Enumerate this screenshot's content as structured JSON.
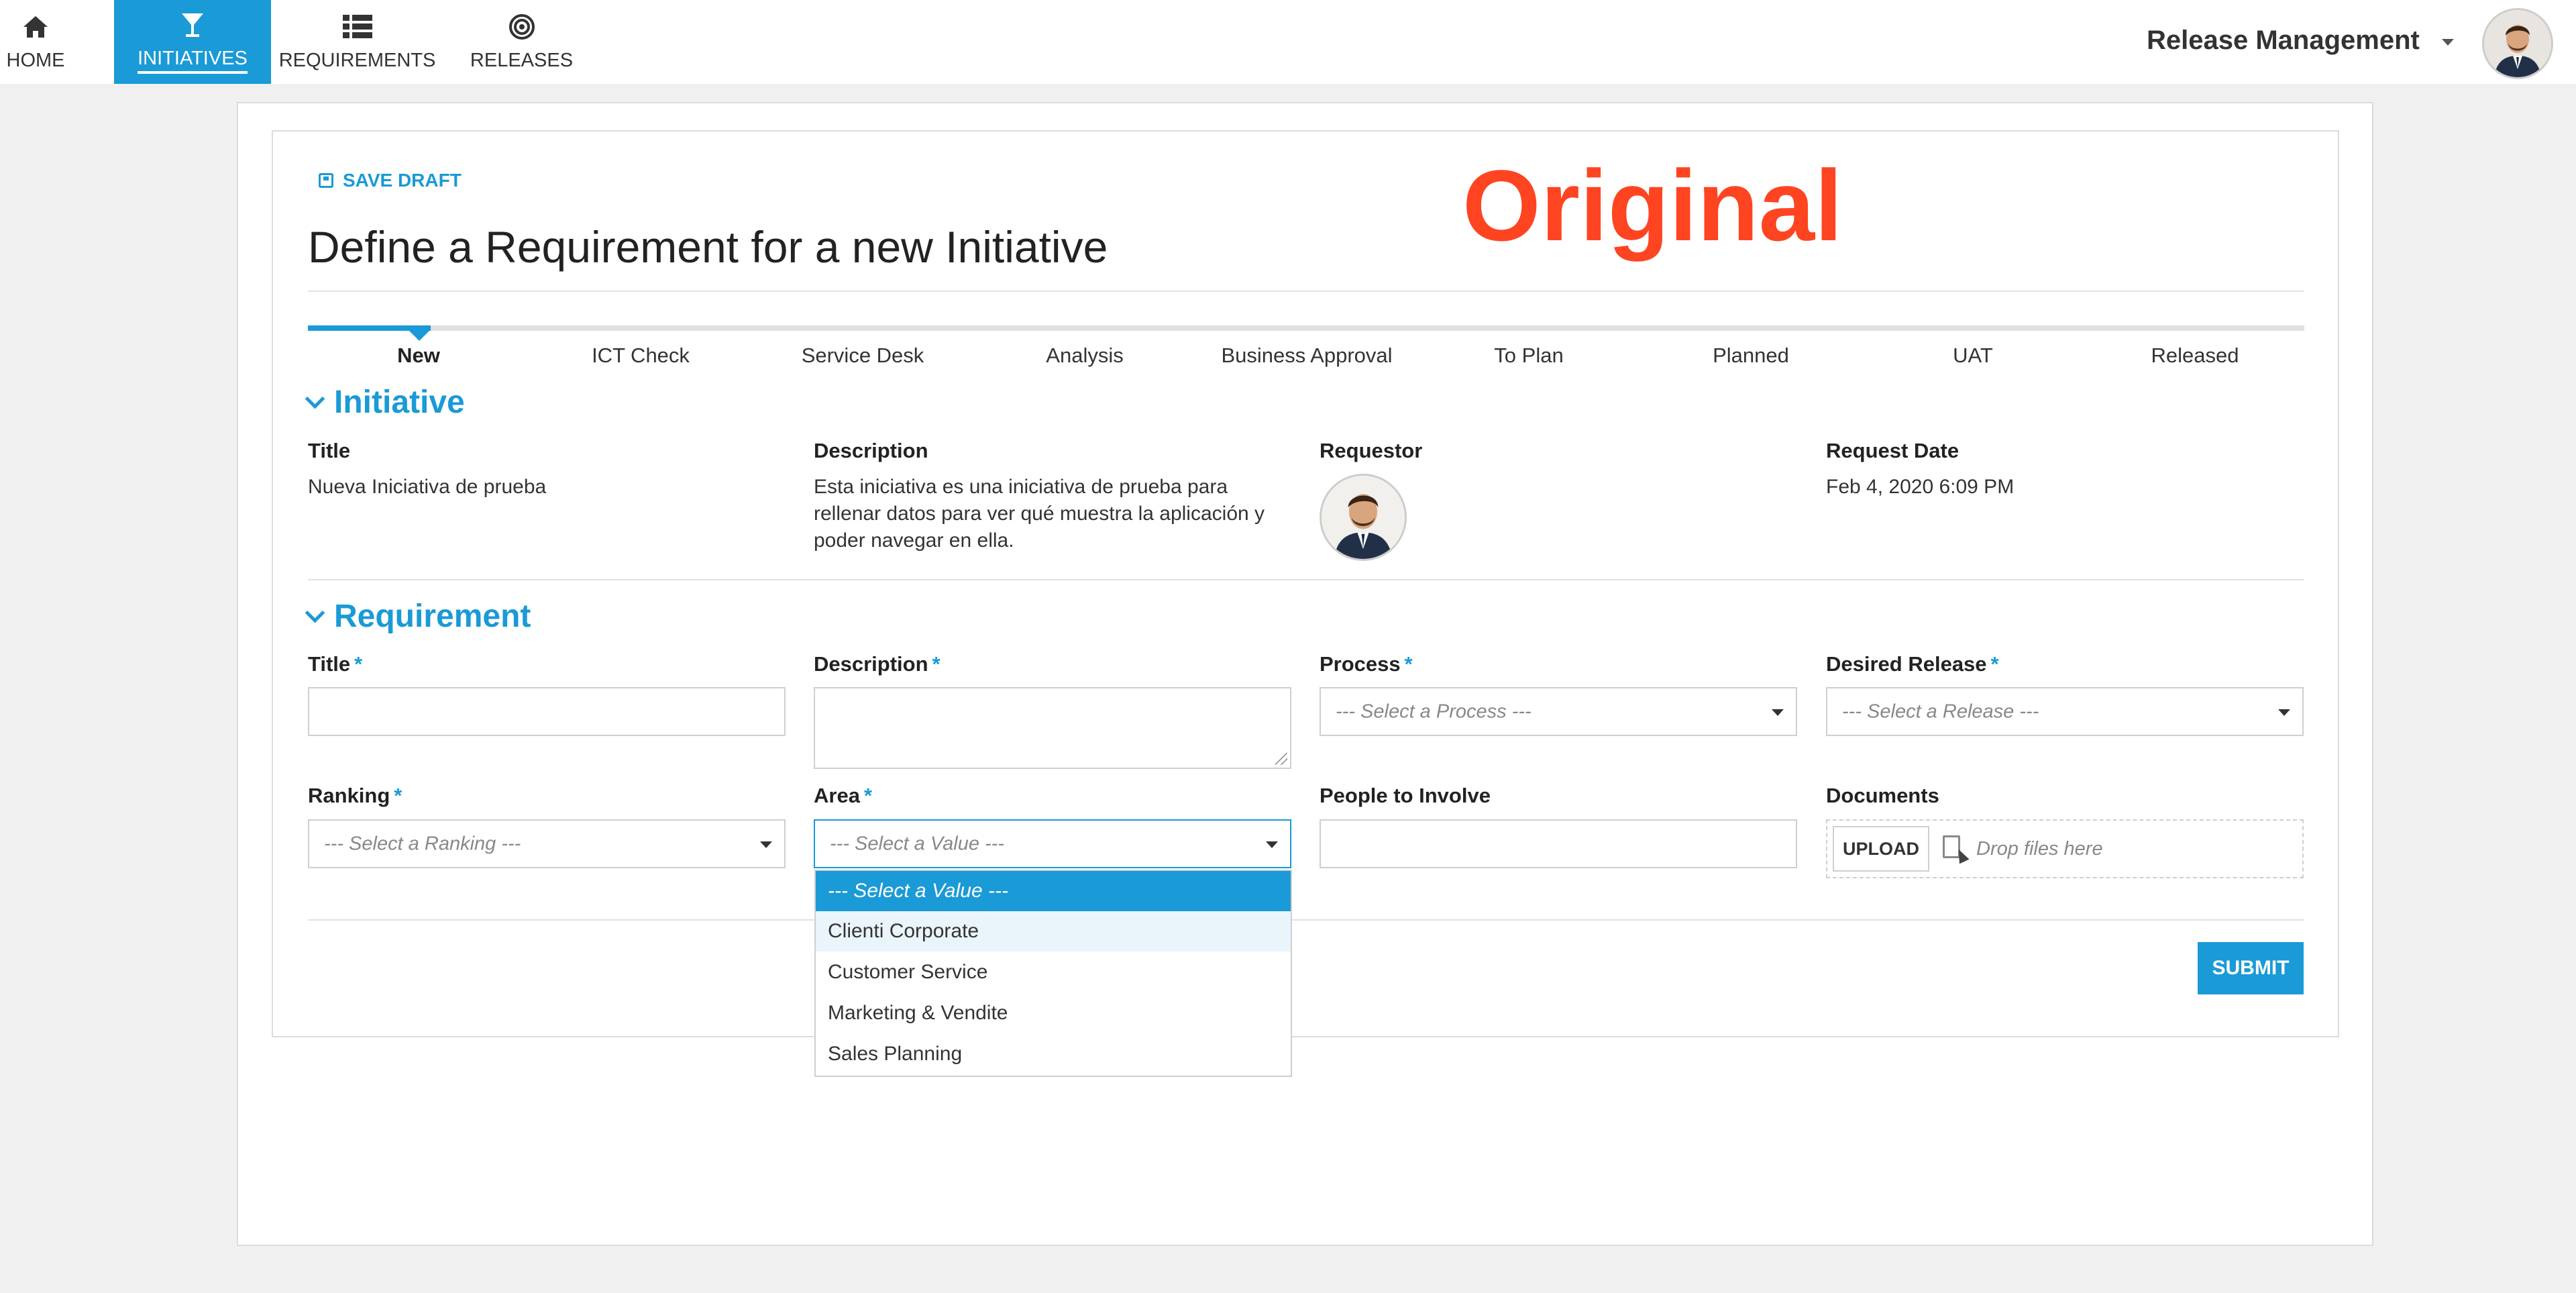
{
  "nav": {
    "items": [
      {
        "label": "HOME",
        "icon": "home-icon"
      },
      {
        "label": "INITIATIVES",
        "icon": "cocktail-glass-icon",
        "active": true
      },
      {
        "label": "REQUIREMENTS",
        "icon": "list-icon"
      },
      {
        "label": "RELEASES",
        "icon": "target-icon"
      }
    ],
    "user_menu_label": "Release Management"
  },
  "page": {
    "save_draft_label": "SAVE DRAFT",
    "title": "Define a Requirement for a new Initiative",
    "watermark": "Original"
  },
  "stepper": {
    "steps": [
      "New",
      "ICT Check",
      "Service Desk",
      "Analysis",
      "Business Approval",
      "To Plan",
      "Planned",
      "UAT",
      "Released"
    ],
    "active_index": 0
  },
  "initiative": {
    "section_title": "Initiative",
    "title_label": "Title",
    "title_value": "Nueva Iniciativa de prueba",
    "description_label": "Description",
    "description_lines": [
      "Esta iniciativa es una iniciativa de prueba para",
      "rellenar datos para ver qué muestra la aplicación y",
      "poder navegar en ella."
    ],
    "requestor_label": "Requestor",
    "request_date_label": "Request Date",
    "request_date_value": "Feb 4, 2020 6:09 PM"
  },
  "requirement": {
    "section_title": "Requirement",
    "required_mark": "*",
    "title_label": "Title",
    "description_label": "Description",
    "process_label": "Process",
    "process_placeholder": "--- Select a Process ---",
    "release_label": "Desired Release",
    "release_placeholder": "--- Select a Release ---",
    "ranking_label": "Ranking",
    "ranking_placeholder": "--- Select a Ranking ---",
    "area_label": "Area",
    "area_placeholder": "--- Select a Value ---",
    "people_label": "People to Involve",
    "documents_label": "Documents",
    "upload_label": "UPLOAD",
    "drop_text": "Drop files here",
    "area_options": [
      "--- Select a Value ---",
      "Clienti Corporate",
      "Customer Service",
      "Marketing & Vendite",
      "Sales Planning"
    ],
    "submit_label": "SUBMIT"
  },
  "colors": {
    "accent": "#1a9ad6",
    "watermark": "#ff4422"
  }
}
